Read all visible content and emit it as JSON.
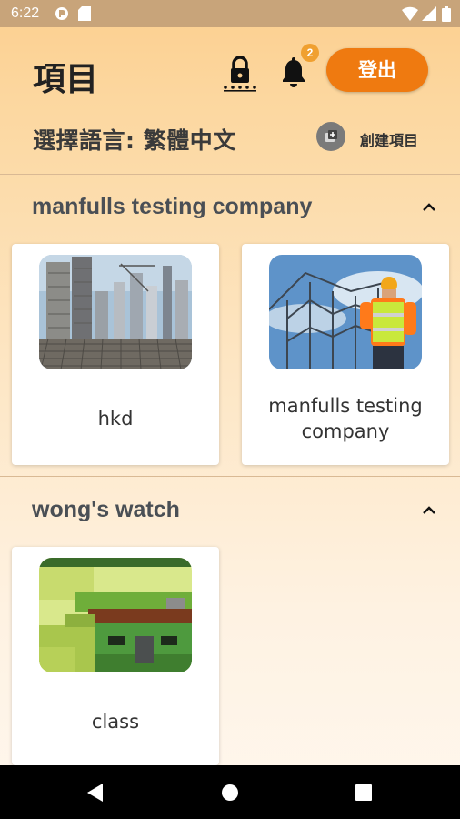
{
  "status_bar": {
    "time": "6:22"
  },
  "header": {
    "title": "項目",
    "notification_count": "2",
    "logout_label": "登出"
  },
  "language": {
    "label": "選擇語言: 繁體中文"
  },
  "create_project_label": "創建項目",
  "sections": [
    {
      "title": "manfulls testing company",
      "projects": [
        {
          "label": "hkd",
          "image": "construction-site-photo"
        },
        {
          "label": "manfulls testing company",
          "image": "construction-worker-photo"
        }
      ]
    },
    {
      "title": "wong's watch",
      "projects": [
        {
          "label": "class",
          "image": "pixel-house-image"
        }
      ]
    }
  ],
  "colors": {
    "accent": "#ef7a10",
    "badge": "#f0a030",
    "status_bar": "#c8a47a",
    "background_top": "#fccf8f"
  }
}
